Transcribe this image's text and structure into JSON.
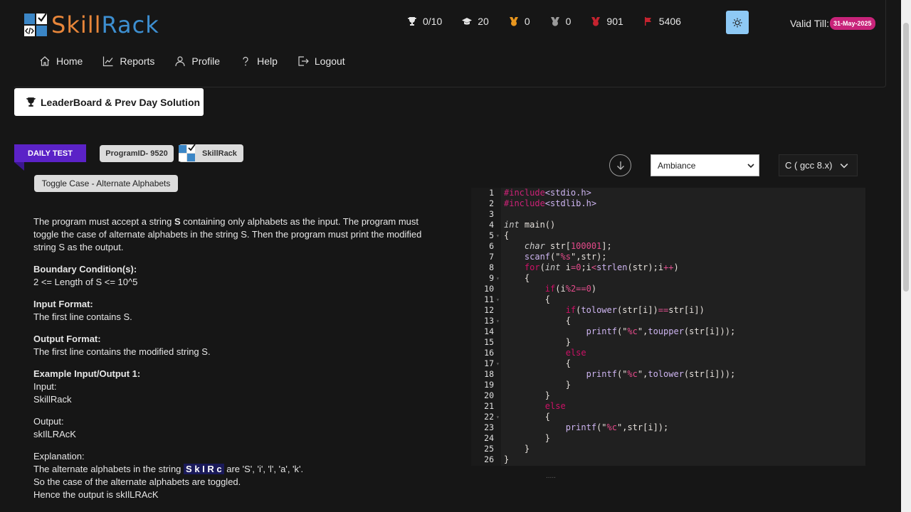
{
  "brand": {
    "name_part1": "Skill",
    "name_part2": "Rack"
  },
  "stats": [
    {
      "icon": "trophy-icon",
      "value": "0/10"
    },
    {
      "icon": "graduation-cap-icon",
      "value": "20"
    },
    {
      "icon": "gold-medal-icon",
      "value": "0"
    },
    {
      "icon": "silver-medal-icon",
      "value": "0"
    },
    {
      "icon": "bronze-medal-icon",
      "value": "901"
    },
    {
      "icon": "flag-icon",
      "value": "5406"
    }
  ],
  "validity": {
    "label": "Valid Till:",
    "date": "31-May-2025"
  },
  "nav": [
    {
      "icon": "home-icon",
      "label": "Home"
    },
    {
      "icon": "reports-icon",
      "label": "Reports"
    },
    {
      "icon": "profile-icon",
      "label": "Profile"
    },
    {
      "icon": "help-icon",
      "label": "Help"
    },
    {
      "icon": "logout-icon",
      "label": "Logout"
    }
  ],
  "leaderboard_button": "LeaderBoard & Prev Day Solution",
  "badges": {
    "daily": "DAILY TEST",
    "program_id": "ProgramID- 9520",
    "source": "SkillRack",
    "title": "Toggle Case - Alternate Alphabets"
  },
  "problem": {
    "intro_a": "The program must accept a string ",
    "intro_s": "S",
    "intro_b": " containing only alphabets as the input. The program must toggle the case of alternate alphabets in the string S. Then the program must print the modified string S as the output.",
    "boundary_title": "Boundary Condition(s):",
    "boundary": "2 <= Length of S <= 10^5",
    "input_title": "Input Format:",
    "input": "The first line contains S.",
    "output_title": "Output Format:",
    "output": "The first line contains the modified string S.",
    "example_title": "Example Input/Output 1:",
    "input_label": "Input:",
    "input_value": "SkillRack",
    "output_label": "Output:",
    "output_value": "skIlLRAcK",
    "explanation_label": "Explanation:",
    "explanation_a": "The alternate alphabets in the string ",
    "explanation_hl": "S k I R c",
    "explanation_b": " are 'S', 'i', 'l', 'a', 'k'.",
    "explanation_2": "So the case of the alternate alphabets are toggled.",
    "explanation_3": "Hence the output is skIlLRAcK"
  },
  "editor": {
    "theme": "Ambiance",
    "language": "C ( gcc 8.x)"
  },
  "colors": {
    "daily_badge": "#5b22c7",
    "valid_badge": "#c8247a",
    "theme_button": "#8ec9f5"
  }
}
